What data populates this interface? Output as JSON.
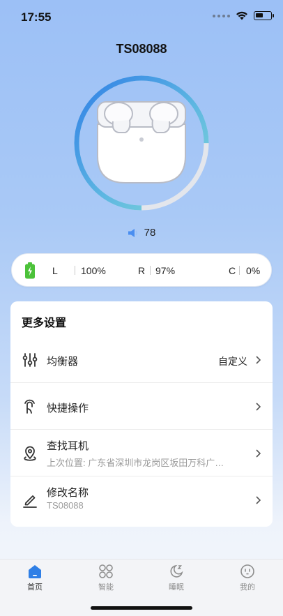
{
  "status_bar": {
    "time": "17:55"
  },
  "device": {
    "name": "TS08088"
  },
  "volume": {
    "value": "78"
  },
  "battery": {
    "left_label": "L",
    "left_value": "100%",
    "right_label": "R",
    "right_value": "97%",
    "case_label": "C",
    "case_value": "0%",
    "ring_level": 0.75
  },
  "settings": {
    "title": "更多设置",
    "items": [
      {
        "title": "均衡器",
        "value": "自定义"
      },
      {
        "title": "快捷操作"
      },
      {
        "title": "查找耳机",
        "subtitle": "上次位置: 广东省深圳市龙岗区坂田万科广…"
      },
      {
        "title": "修改名称",
        "subtitle": "TS08088"
      }
    ]
  },
  "tabs": [
    {
      "label": "首页",
      "icon": "home-icon",
      "active": true
    },
    {
      "label": "智能",
      "icon": "smart-grid-icon"
    },
    {
      "label": "睡眠",
      "icon": "sleep-moon-icon"
    },
    {
      "label": "我的",
      "icon": "profile-face-icon"
    }
  ],
  "colors": {
    "accent": "#2f7fe6",
    "ring_teal": "#7fd3d9",
    "battery_green": "#4cc23a",
    "ring_track": "#e3e6ec"
  }
}
